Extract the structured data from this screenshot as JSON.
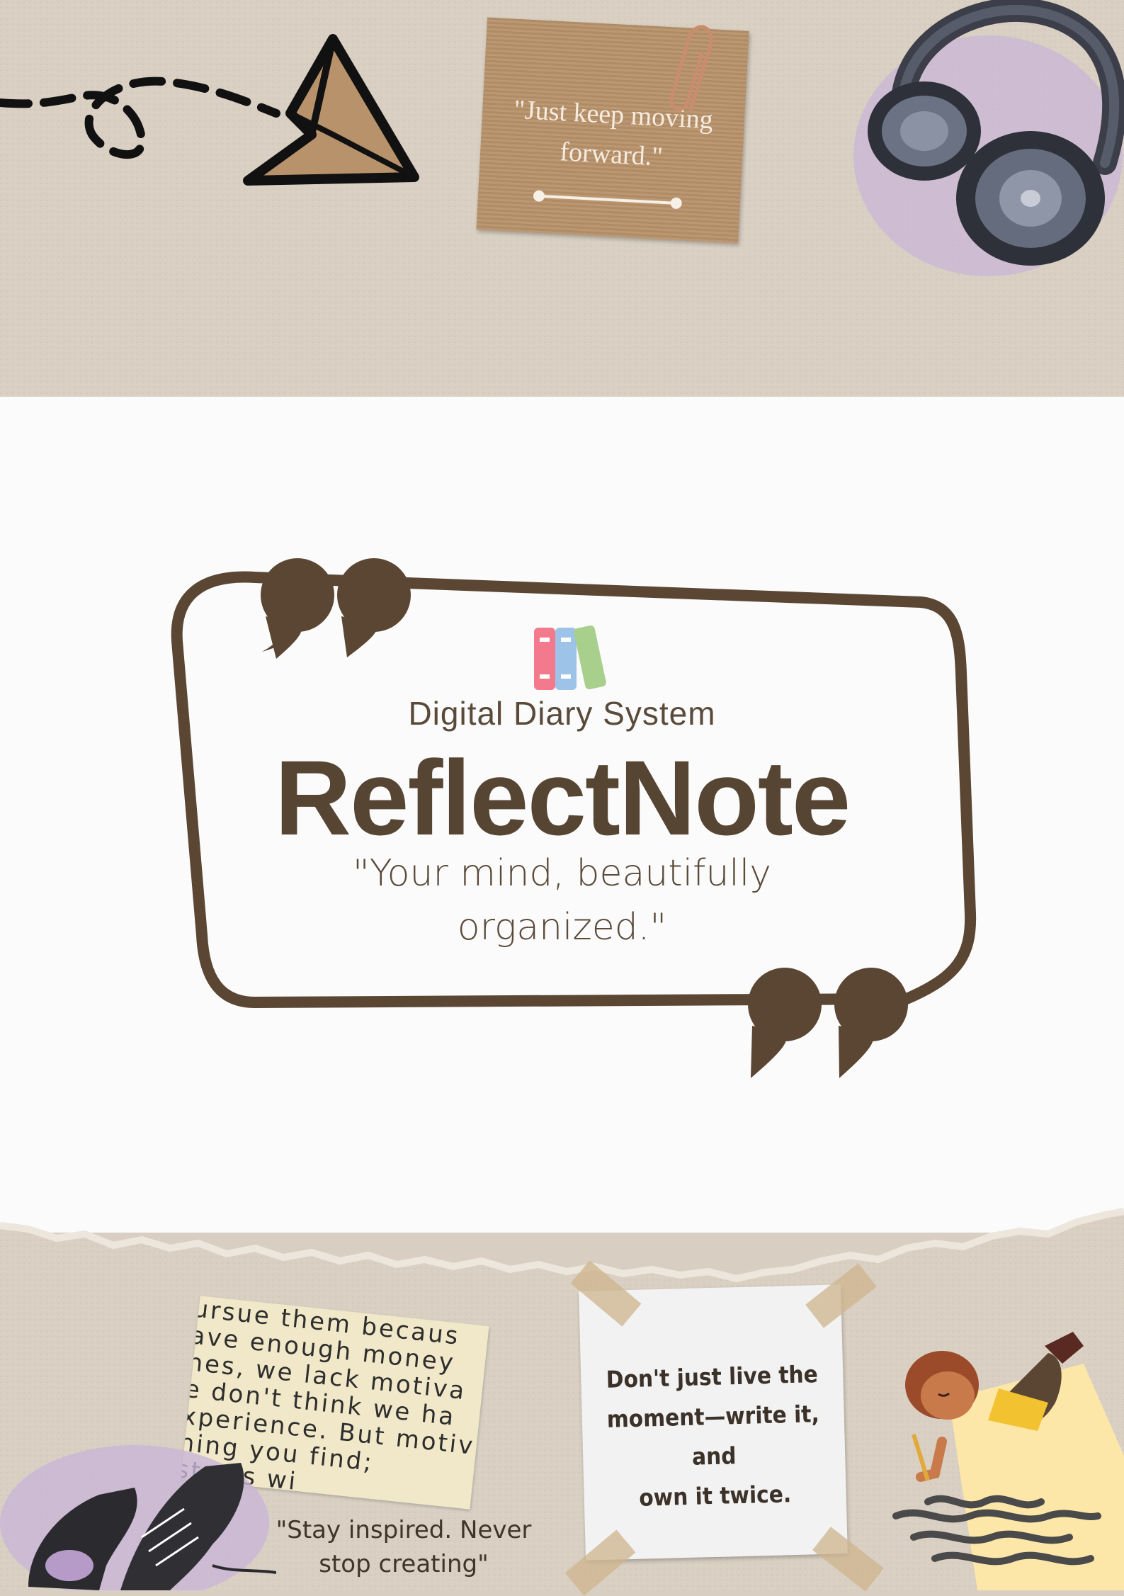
{
  "top_note": {
    "quote": "\"Just keep moving forward.\""
  },
  "header": {
    "subtitle": "Digital Diary System",
    "brand": "ReflectNote",
    "tagline_line1": "\"Your mind, beautifully",
    "tagline_line2": "organized.\""
  },
  "poster_lines": [
    "ursue them becaus",
    "ave enough money",
    "nes, we lack motiva",
    "e don't think we ha",
    "xperience. But motiv",
    "ning you find;",
    "starts wi"
  ],
  "sticky_note": {
    "line1": "Don't just live the",
    "line2": "moment—write it, and",
    "line3": "own it twice."
  },
  "bottom_quote": {
    "line1": "\"Stay inspired. Never",
    "line2": "stop creating\""
  },
  "colors": {
    "paper": "#d8cfc2",
    "brand_brown": "#574533",
    "book_pink": "#f27a8c",
    "book_blue": "#9dc3e8",
    "book_green": "#a8cf8c"
  },
  "icons": [
    "paper-plane-icon",
    "headphones-icon",
    "paperclip-icon",
    "books-icon",
    "sneakers-icon",
    "writing-child-icon"
  ]
}
